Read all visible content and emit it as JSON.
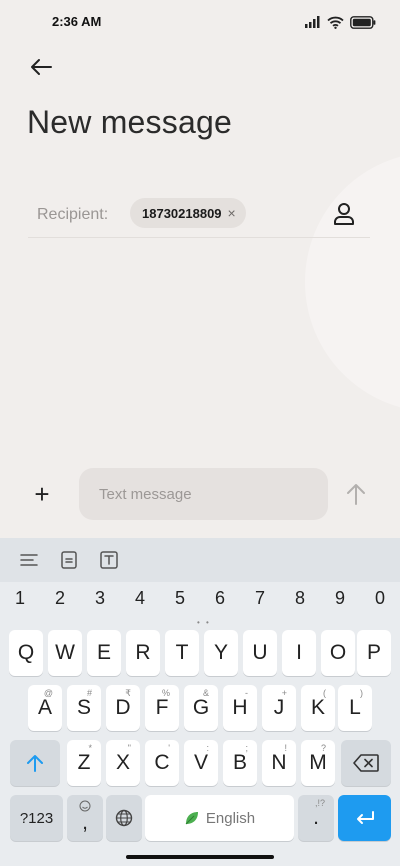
{
  "status_bar": {
    "time": "2:36 AM",
    "icons": [
      "signal-icon",
      "wifi-icon",
      "battery-icon"
    ]
  },
  "header": {
    "back_icon": "arrow-left-icon",
    "title": "New message"
  },
  "recipient": {
    "label": "Recipient:",
    "chip_text": "18730218809",
    "chip_remove": "×",
    "contact_icon": "person-icon"
  },
  "compose": {
    "attach_icon": "plus-icon",
    "attach_label": "+",
    "placeholder": "Text message",
    "value": "",
    "send_icon": "arrow-up-icon"
  },
  "keyboard": {
    "toolbar_icons": [
      "menu-lines-icon",
      "clipboard-icon",
      "text-box-icon"
    ],
    "number_row": [
      "1",
      "2",
      "3",
      "4",
      "5",
      "6",
      "7",
      "8",
      "9",
      "0"
    ],
    "row1": [
      "Q",
      "W",
      "E",
      "R",
      "T",
      "Y",
      "U",
      "I",
      "O",
      "P"
    ],
    "row2": [
      {
        "key": "A",
        "hint": "@"
      },
      {
        "key": "S",
        "hint": "#"
      },
      {
        "key": "D",
        "hint": "₹"
      },
      {
        "key": "F",
        "hint": "%"
      },
      {
        "key": "G",
        "hint": "&"
      },
      {
        "key": "H",
        "hint": "-"
      },
      {
        "key": "J",
        "hint": "+"
      },
      {
        "key": "K",
        "hint": "("
      },
      {
        "key": "L",
        "hint": ")"
      }
    ],
    "row3": [
      {
        "key": "Z",
        "hint": "*"
      },
      {
        "key": "X",
        "hint": "\""
      },
      {
        "key": "C",
        "hint": "'"
      },
      {
        "key": "V",
        "hint": ":"
      },
      {
        "key": "B",
        "hint": ";"
      },
      {
        "key": "N",
        "hint": "!"
      },
      {
        "key": "M",
        "hint": "?"
      }
    ],
    "symbols_key": "?123",
    "comma_key": ",",
    "space_label": "English",
    "period_key": ".",
    "period_hint": ",!?",
    "accent_color": "#1e9bf0"
  }
}
